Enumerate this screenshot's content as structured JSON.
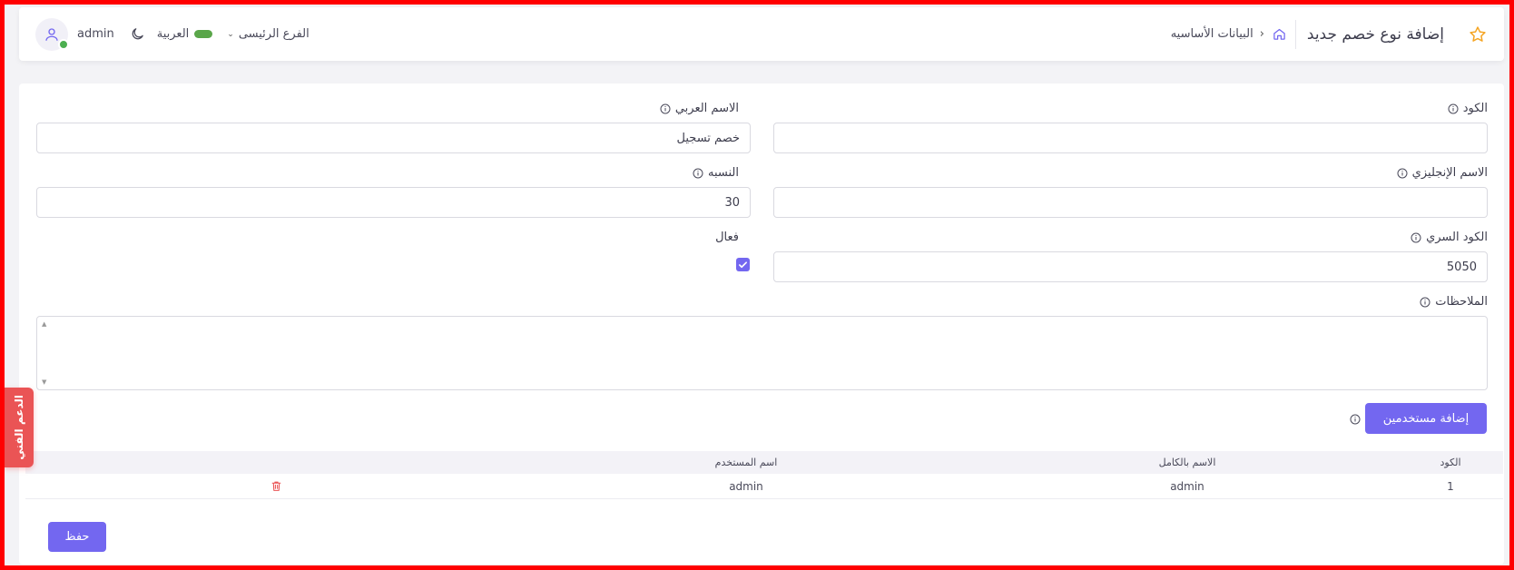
{
  "header": {
    "page_title": "إضافة نوع خصم جديد",
    "breadcrumb": "البيانات الأساسيه",
    "breadcrumb_separator": "›",
    "user_name": "admin",
    "language": "العربية",
    "branch": "الفرع الرئيسى",
    "branch_chevron": "⌄"
  },
  "form": {
    "code": {
      "label": "الكود",
      "value": ""
    },
    "arabic_name": {
      "label": "الاسم العربي",
      "value": "خصم تسجيل"
    },
    "english_name": {
      "label": "الاسم الإنجليزي",
      "value": ""
    },
    "percentage": {
      "label": "النسبه",
      "value": "30"
    },
    "secret_code": {
      "label": "الكود السري",
      "value": "5050"
    },
    "active": {
      "label": "فعال",
      "checked": true
    },
    "notes": {
      "label": "الملاحظات",
      "value": ""
    },
    "add_users_button": "إضافة مستخدمين",
    "save_button": "حفظ"
  },
  "users_table": {
    "columns": [
      "الكود",
      "الاسم بالكامل",
      "اسم المستخدم"
    ],
    "rows": [
      {
        "code": "1",
        "full_name": "admin",
        "username": "admin"
      }
    ]
  },
  "support_tab": "الدعم الفني",
  "colors": {
    "primary": "#7367f0",
    "danger": "#ea5455",
    "star": "#f5a524",
    "online": "#4caf50",
    "language_pill": "#5aa64a"
  }
}
